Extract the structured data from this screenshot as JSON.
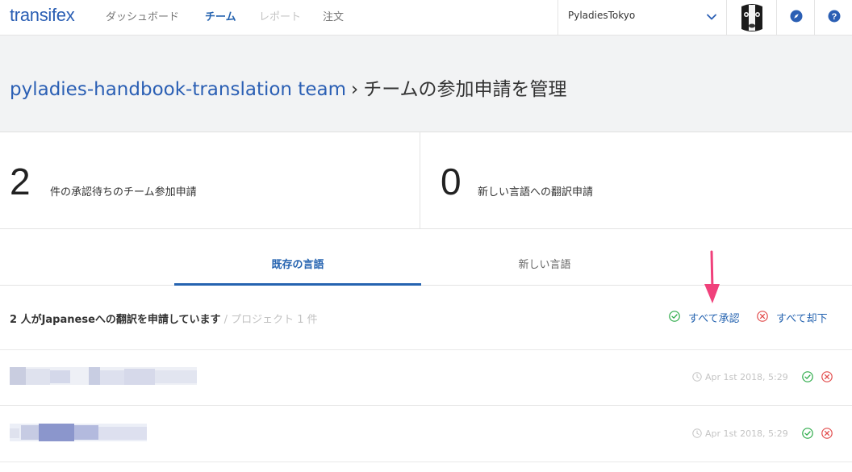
{
  "nav": {
    "logo": "transifex",
    "links": [
      "ダッシュボード",
      "チーム",
      "レポート",
      "注文"
    ],
    "org": "PyladiesTokyo"
  },
  "header": {
    "team": "pyladies-handbook-translation team",
    "separator": "›",
    "page_title": "チームの参加申請を管理"
  },
  "stats": [
    {
      "number": "2",
      "label": "件の承認待ちのチーム参加申請"
    },
    {
      "number": "0",
      "label": "新しい言語への翻訳申請"
    }
  ],
  "tabs": [
    {
      "label": "既存の言語",
      "active": true
    },
    {
      "label": "新しい言語",
      "active": false
    }
  ],
  "summary": {
    "main": "2 人がJapaneseへの翻訳を申請しています",
    "sub": " / プロジェクト 1 件",
    "approve_all": "すべて承認",
    "reject_all": "すべて却下"
  },
  "requests": [
    {
      "timestamp": "Apr 1st 2018, 5:29"
    },
    {
      "timestamp": "Apr 1st 2018, 5:29"
    }
  ],
  "colors": {
    "brand": "#2b5fb4",
    "approve": "#2eab4a",
    "reject": "#e24b4b",
    "annotation": "#f0417b"
  },
  "icons": {
    "org_chevron": "chevron-down-icon",
    "compass": "compass-icon",
    "help": "help-icon",
    "approve": "check-circle-icon",
    "reject": "x-circle-icon",
    "clock": "clock-icon"
  }
}
